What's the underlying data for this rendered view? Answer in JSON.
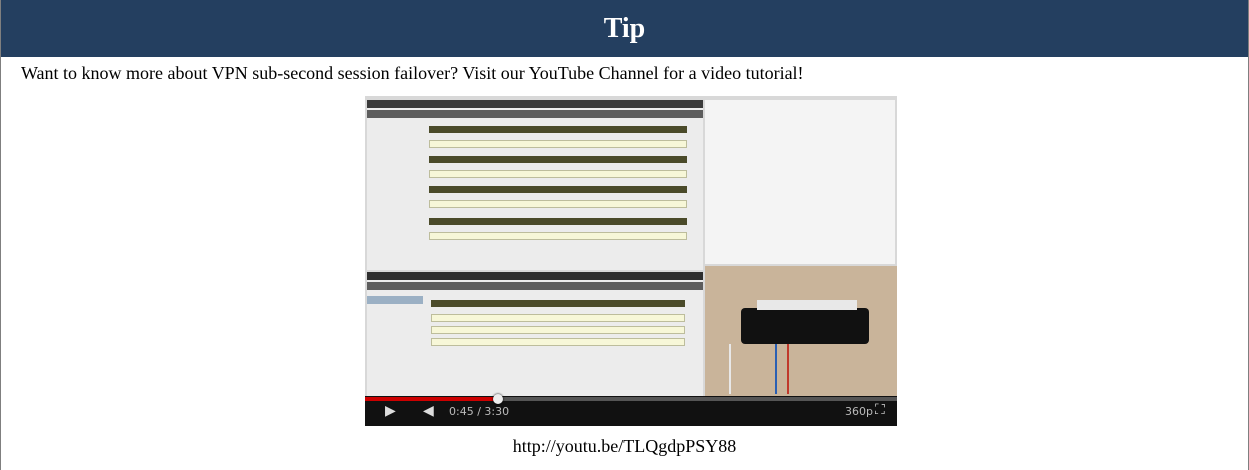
{
  "tip": {
    "title": "Tip",
    "message": "Want to know more about VPN sub-second session failover? Visit our YouTube Channel for a video tutorial!",
    "link": "http://youtu.be/TLQgdpPSY88"
  },
  "video": {
    "progress": 0.25,
    "time": "0:45 / 3:30",
    "quality": "360p",
    "colors": {
      "header_bg": "#243f60",
      "progress": "#cc0000",
      "player_bar": "#111111"
    },
    "icons": [
      "play-icon",
      "volume-icon",
      "fullscreen-icon"
    ]
  }
}
